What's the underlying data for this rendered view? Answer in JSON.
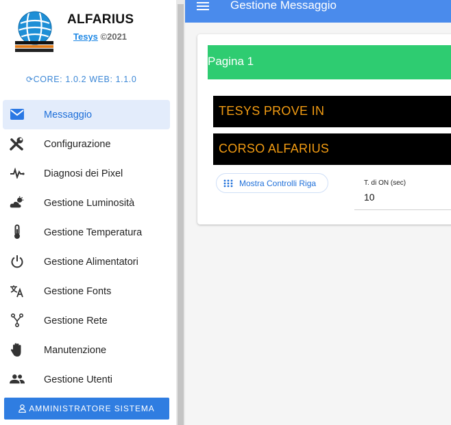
{
  "app": {
    "title": "ALFARIUS",
    "company_link": "Tesys",
    "copyright": "©2021",
    "version": "CORE: 1.0.2 WEB: 1.1.0"
  },
  "sidebar": {
    "items": [
      {
        "label": "Messaggio",
        "icon": "mail-icon",
        "active": true
      },
      {
        "label": "Configurazione",
        "icon": "tools-icon"
      },
      {
        "label": "Diagnosi dei Pixel",
        "icon": "pulse-icon"
      },
      {
        "label": "Gestione Luminosità",
        "icon": "weather-icon"
      },
      {
        "label": "Gestione Temperatura",
        "icon": "thermometer-icon"
      },
      {
        "label": "Gestione Alimentatori",
        "icon": "power-icon"
      },
      {
        "label": "Gestione Fonts",
        "icon": "translate-icon"
      },
      {
        "label": "Gestione Rete",
        "icon": "network-icon"
      },
      {
        "label": "Manutenzione",
        "icon": "hand-icon"
      },
      {
        "label": "Gestione Utenti",
        "icon": "users-icon"
      }
    ],
    "admin_button": "AMMINISTRATORE SISTEMA"
  },
  "appbar": {
    "title": "Gestione Messaggio"
  },
  "main": {
    "page_label": "Pagina 1",
    "led_lines": [
      "TESYS PROVE IN",
      "CORSO ALFARIUS"
    ],
    "row_controls_button": "Mostra Controlli Riga",
    "on_time": {
      "label": "T. di ON (sec)",
      "value": "10"
    }
  },
  "colors": {
    "accent": "#4a8bec",
    "page_bar": "#2ecc71",
    "led_text": "#f39c12",
    "led_background": "#000000"
  }
}
